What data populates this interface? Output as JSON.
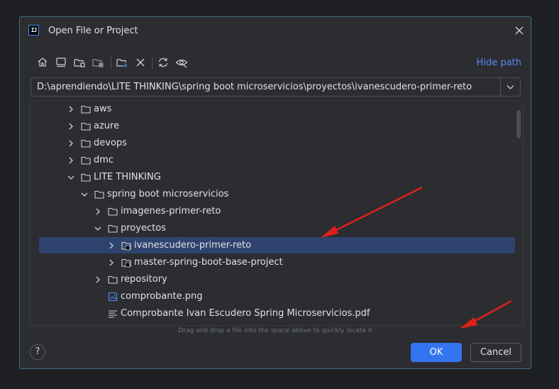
{
  "dialog": {
    "title": "Open File or Project",
    "app_logo": "IJ",
    "hide_path_label": "Hide path",
    "path_value": "D:\\aprendiendo\\LITE THINKING\\spring boot microservicios\\proyectos\\ivanescudero-primer-reto",
    "hint": "Drag and drop a file into the space above to quickly locate it",
    "help_label": "?",
    "ok_label": "OK",
    "cancel_label": "Cancel"
  },
  "toolbar_icons": [
    "home-icon",
    "desktop-icon",
    "project-folder-icon",
    "module-folder-icon",
    "new-folder-icon",
    "delete-icon",
    "refresh-icon",
    "show-hidden-icon"
  ],
  "tree": {
    "rows": [
      {
        "label": "aws",
        "icon": "folder-icon",
        "expanded": false
      },
      {
        "label": "azure",
        "icon": "folder-icon",
        "expanded": false
      },
      {
        "label": "devops",
        "icon": "folder-icon",
        "expanded": false
      },
      {
        "label": "dmc",
        "icon": "folder-icon",
        "expanded": false
      },
      {
        "label": "LITE THINKING",
        "icon": "folder-icon",
        "expanded": true
      },
      {
        "label": "spring boot microservicios",
        "icon": "folder-icon",
        "expanded": true
      },
      {
        "label": "imagenes-primer-reto",
        "icon": "folder-icon",
        "expanded": false
      },
      {
        "label": "proyectos",
        "icon": "folder-icon",
        "expanded": true
      },
      {
        "label": "ivanescudero-primer-reto",
        "icon": "project-folder-icon",
        "expanded": false,
        "selected": true
      },
      {
        "label": "master-spring-boot-base-project",
        "icon": "project-folder-icon",
        "expanded": false
      },
      {
        "label": "repository",
        "icon": "folder-icon",
        "expanded": false
      },
      {
        "label": "comprobante.png",
        "icon": "image-file-icon"
      },
      {
        "label": "Comprobante Ivan Escudero Spring Microservicios.pdf",
        "icon": "text-file-icon"
      }
    ]
  },
  "colors": {
    "accent": "#3574f0",
    "selection": "#2e436e",
    "annotation_arrow": "#e0201a",
    "link": "#548af7"
  }
}
